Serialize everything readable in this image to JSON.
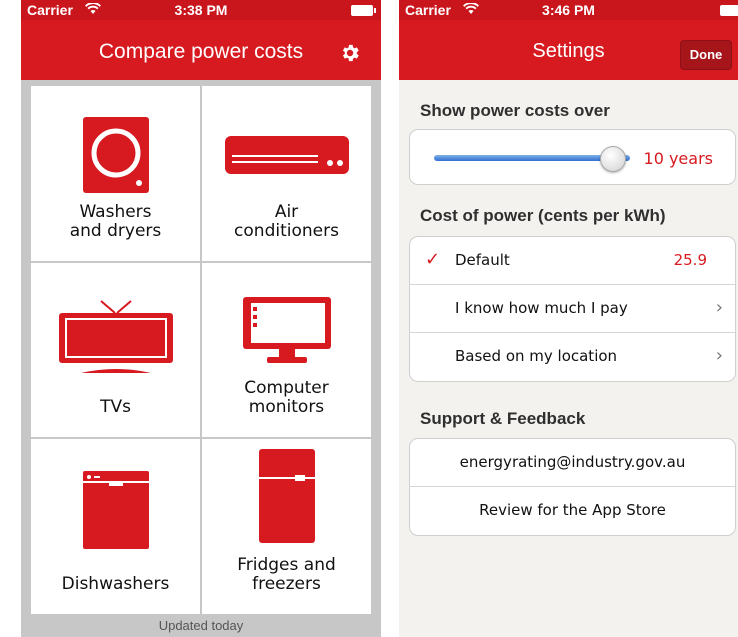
{
  "left_screen": {
    "status_bar": {
      "carrier": "Carrier",
      "wifi_icon": "wifi-icon",
      "time": "3:38 PM",
      "battery_icon": "battery-icon"
    },
    "nav": {
      "title": "Compare power costs",
      "settings_icon": "gear-icon"
    },
    "tiles": [
      {
        "label": "Washers\nand dryers",
        "icon": "washer-icon"
      },
      {
        "label": "Air\nconditioners",
        "icon": "air-conditioner-icon"
      },
      {
        "label": "TVs",
        "icon": "tv-icon"
      },
      {
        "label": "Computer\nmonitors",
        "icon": "monitor-icon"
      },
      {
        "label": "Dishwashers",
        "icon": "dishwasher-icon"
      },
      {
        "label": "Fridges and\nfreezers",
        "icon": "fridge-icon"
      }
    ],
    "footer": "Updated today"
  },
  "right_screen": {
    "status_bar": {
      "carrier": "Carrier",
      "wifi_icon": "wifi-icon",
      "time": "3:46 PM",
      "battery_icon": "battery-icon"
    },
    "nav": {
      "title": "Settings",
      "done_label": "Done"
    },
    "power_costs_section": {
      "header": "Show power costs over",
      "slider_value_label": "10 years",
      "slider_fraction": 0.97
    },
    "cost_section": {
      "header": "Cost of power (cents per kWh)",
      "rows": [
        {
          "label": "Default",
          "value": "25.9",
          "checked": true
        },
        {
          "label": "I know how much I pay",
          "has_chevron": true
        },
        {
          "label": "Based on my location",
          "has_chevron": true
        }
      ]
    },
    "support_section": {
      "header": "Support & Feedback",
      "rows": [
        {
          "label": "energyrating@industry.gov.au"
        },
        {
          "label": "Review for the App Store"
        }
      ]
    }
  },
  "colors": {
    "brand_red": "#d71920",
    "slider_blue": "#2f6fd1"
  }
}
